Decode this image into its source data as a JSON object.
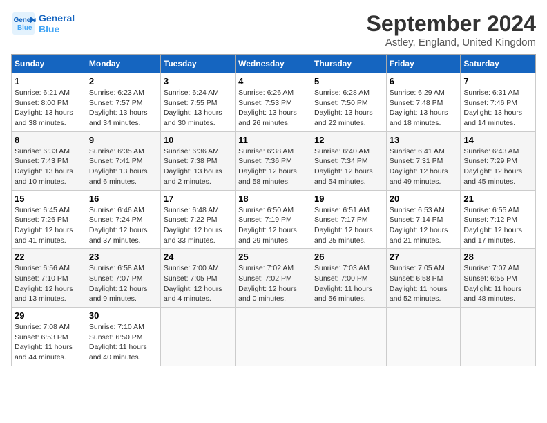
{
  "header": {
    "logo_line1": "General",
    "logo_line2": "Blue",
    "month_title": "September 2024",
    "subtitle": "Astley, England, United Kingdom"
  },
  "days_of_week": [
    "Sunday",
    "Monday",
    "Tuesday",
    "Wednesday",
    "Thursday",
    "Friday",
    "Saturday"
  ],
  "weeks": [
    [
      {
        "num": "1",
        "lines": [
          "Sunrise: 6:21 AM",
          "Sunset: 8:00 PM",
          "Daylight: 13 hours",
          "and 38 minutes."
        ]
      },
      {
        "num": "2",
        "lines": [
          "Sunrise: 6:23 AM",
          "Sunset: 7:57 PM",
          "Daylight: 13 hours",
          "and 34 minutes."
        ]
      },
      {
        "num": "3",
        "lines": [
          "Sunrise: 6:24 AM",
          "Sunset: 7:55 PM",
          "Daylight: 13 hours",
          "and 30 minutes."
        ]
      },
      {
        "num": "4",
        "lines": [
          "Sunrise: 6:26 AM",
          "Sunset: 7:53 PM",
          "Daylight: 13 hours",
          "and 26 minutes."
        ]
      },
      {
        "num": "5",
        "lines": [
          "Sunrise: 6:28 AM",
          "Sunset: 7:50 PM",
          "Daylight: 13 hours",
          "and 22 minutes."
        ]
      },
      {
        "num": "6",
        "lines": [
          "Sunrise: 6:29 AM",
          "Sunset: 7:48 PM",
          "Daylight: 13 hours",
          "and 18 minutes."
        ]
      },
      {
        "num": "7",
        "lines": [
          "Sunrise: 6:31 AM",
          "Sunset: 7:46 PM",
          "Daylight: 13 hours",
          "and 14 minutes."
        ]
      }
    ],
    [
      {
        "num": "8",
        "lines": [
          "Sunrise: 6:33 AM",
          "Sunset: 7:43 PM",
          "Daylight: 13 hours",
          "and 10 minutes."
        ]
      },
      {
        "num": "9",
        "lines": [
          "Sunrise: 6:35 AM",
          "Sunset: 7:41 PM",
          "Daylight: 13 hours",
          "and 6 minutes."
        ]
      },
      {
        "num": "10",
        "lines": [
          "Sunrise: 6:36 AM",
          "Sunset: 7:38 PM",
          "Daylight: 13 hours",
          "and 2 minutes."
        ]
      },
      {
        "num": "11",
        "lines": [
          "Sunrise: 6:38 AM",
          "Sunset: 7:36 PM",
          "Daylight: 12 hours",
          "and 58 minutes."
        ]
      },
      {
        "num": "12",
        "lines": [
          "Sunrise: 6:40 AM",
          "Sunset: 7:34 PM",
          "Daylight: 12 hours",
          "and 54 minutes."
        ]
      },
      {
        "num": "13",
        "lines": [
          "Sunrise: 6:41 AM",
          "Sunset: 7:31 PM",
          "Daylight: 12 hours",
          "and 49 minutes."
        ]
      },
      {
        "num": "14",
        "lines": [
          "Sunrise: 6:43 AM",
          "Sunset: 7:29 PM",
          "Daylight: 12 hours",
          "and 45 minutes."
        ]
      }
    ],
    [
      {
        "num": "15",
        "lines": [
          "Sunrise: 6:45 AM",
          "Sunset: 7:26 PM",
          "Daylight: 12 hours",
          "and 41 minutes."
        ]
      },
      {
        "num": "16",
        "lines": [
          "Sunrise: 6:46 AM",
          "Sunset: 7:24 PM",
          "Daylight: 12 hours",
          "and 37 minutes."
        ]
      },
      {
        "num": "17",
        "lines": [
          "Sunrise: 6:48 AM",
          "Sunset: 7:22 PM",
          "Daylight: 12 hours",
          "and 33 minutes."
        ]
      },
      {
        "num": "18",
        "lines": [
          "Sunrise: 6:50 AM",
          "Sunset: 7:19 PM",
          "Daylight: 12 hours",
          "and 29 minutes."
        ]
      },
      {
        "num": "19",
        "lines": [
          "Sunrise: 6:51 AM",
          "Sunset: 7:17 PM",
          "Daylight: 12 hours",
          "and 25 minutes."
        ]
      },
      {
        "num": "20",
        "lines": [
          "Sunrise: 6:53 AM",
          "Sunset: 7:14 PM",
          "Daylight: 12 hours",
          "and 21 minutes."
        ]
      },
      {
        "num": "21",
        "lines": [
          "Sunrise: 6:55 AM",
          "Sunset: 7:12 PM",
          "Daylight: 12 hours",
          "and 17 minutes."
        ]
      }
    ],
    [
      {
        "num": "22",
        "lines": [
          "Sunrise: 6:56 AM",
          "Sunset: 7:10 PM",
          "Daylight: 12 hours",
          "and 13 minutes."
        ]
      },
      {
        "num": "23",
        "lines": [
          "Sunrise: 6:58 AM",
          "Sunset: 7:07 PM",
          "Daylight: 12 hours",
          "and 9 minutes."
        ]
      },
      {
        "num": "24",
        "lines": [
          "Sunrise: 7:00 AM",
          "Sunset: 7:05 PM",
          "Daylight: 12 hours",
          "and 4 minutes."
        ]
      },
      {
        "num": "25",
        "lines": [
          "Sunrise: 7:02 AM",
          "Sunset: 7:02 PM",
          "Daylight: 12 hours",
          "and 0 minutes."
        ]
      },
      {
        "num": "26",
        "lines": [
          "Sunrise: 7:03 AM",
          "Sunset: 7:00 PM",
          "Daylight: 11 hours",
          "and 56 minutes."
        ]
      },
      {
        "num": "27",
        "lines": [
          "Sunrise: 7:05 AM",
          "Sunset: 6:58 PM",
          "Daylight: 11 hours",
          "and 52 minutes."
        ]
      },
      {
        "num": "28",
        "lines": [
          "Sunrise: 7:07 AM",
          "Sunset: 6:55 PM",
          "Daylight: 11 hours",
          "and 48 minutes."
        ]
      }
    ],
    [
      {
        "num": "29",
        "lines": [
          "Sunrise: 7:08 AM",
          "Sunset: 6:53 PM",
          "Daylight: 11 hours",
          "and 44 minutes."
        ]
      },
      {
        "num": "30",
        "lines": [
          "Sunrise: 7:10 AM",
          "Sunset: 6:50 PM",
          "Daylight: 11 hours",
          "and 40 minutes."
        ]
      },
      null,
      null,
      null,
      null,
      null
    ]
  ]
}
